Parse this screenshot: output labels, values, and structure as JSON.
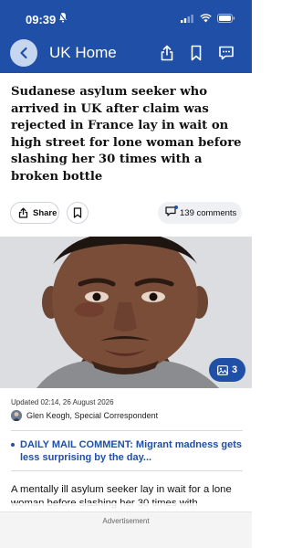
{
  "status_bar": {
    "time": "09:39"
  },
  "nav": {
    "title": "UK Home"
  },
  "article": {
    "headline": "Sudanese asylum seeker who arrived in UK after claim was rejected in France lay in wait on high street for lone woman before slashing her 30 times with a broken bottle",
    "share_label": "Share",
    "comments_label": "139 comments",
    "gallery_count": "3",
    "updated": "Updated 02:14, 26 August 2026",
    "byline": "Glen Keogh, Special Correspondent",
    "related_link": "DAILY MAIL COMMENT: Migrant madness gets less surprising by the day...",
    "body_preview": "A mentally ill asylum seeker lay in wait for a lone woman before slashing her 30 times with"
  },
  "footer": {
    "ad_label": "Advertisement"
  },
  "colors": {
    "brand_blue": "#1f4fa6",
    "back_button_bg": "#c7d6ef"
  },
  "icons": [
    "bell-icon",
    "signal-icon",
    "wifi-icon",
    "battery-icon",
    "back-arrow-icon",
    "share-icon",
    "bookmark-icon",
    "comment-icon",
    "share-small-icon",
    "bookmark-small-icon",
    "comment-bubble-icon",
    "gallery-icon"
  ]
}
